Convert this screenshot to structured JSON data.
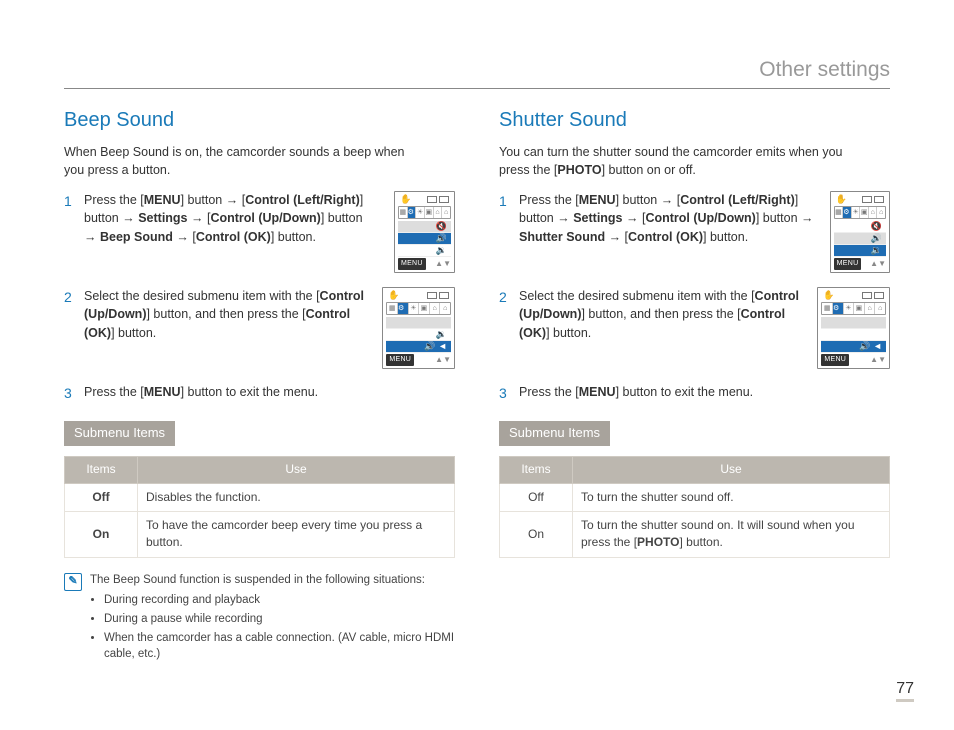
{
  "page_title": "Other settings",
  "page_number": "77",
  "beep": {
    "heading": "Beep Sound",
    "lead": "When Beep Sound is on, the camcorder sounds a beep when you press a button.",
    "steps": [
      {
        "num": "1",
        "pre": "Press the [",
        "btn": "MENU",
        "mid": "] button → [",
        "ctrl_lr": "Control (Left/Right)",
        "mid2": "] button → ",
        "settings": "Settings",
        "mid3": " → [",
        "ctrl_ud": "Control (Up/Down)",
        "mid4": "] button → ",
        "target": "Beep Sound",
        "mid5": " → [",
        "ctrl_ok": "Control (OK)",
        "post": "] button."
      },
      {
        "num": "2",
        "text_a": "Select the desired submenu item with the [",
        "ctrl_ud": "Control (Up/Down)",
        "text_b": "] button, and then press the [",
        "ctrl_ok": "Control (OK)",
        "text_c": "] button."
      },
      {
        "num": "3",
        "text_a": "Press the [",
        "btn": "MENU",
        "text_b": "] button to exit the menu."
      }
    ],
    "submenu_label": "Submenu Items",
    "table": {
      "h1": "Items",
      "h2": "Use",
      "rows": [
        {
          "item": "Off",
          "use": "Disables the function."
        },
        {
          "item": "On",
          "use": "To have the camcorder beep every time you press a button."
        }
      ]
    },
    "note_head": "The Beep Sound function is suspended in the following situations:",
    "note_items": [
      "During recording and playback",
      "During a pause while recording",
      "When the camcorder has a cable connection. (AV cable, micro HDMI cable, etc.)"
    ],
    "lcd_menu_label": "MENU"
  },
  "shutter": {
    "heading": "Shutter Sound",
    "lead_a": "You can turn the shutter sound the camcorder emits when you press the [",
    "lead_btn": "PHOTO",
    "lead_b": "] button on or off.",
    "steps": [
      {
        "num": "1",
        "pre": "Press the [",
        "btn": "MENU",
        "mid": "] button → [",
        "ctrl_lr": "Control (Left/Right)",
        "mid2": "] button → ",
        "settings": "Settings",
        "mid3": " → [",
        "ctrl_ud": "Control (Up/Down)",
        "mid4": "] button → ",
        "target": "Shutter Sound",
        "mid5": " → [",
        "ctrl_ok": "Control (OK)",
        "post": "] button."
      },
      {
        "num": "2",
        "text_a": "Select the desired submenu item with the [",
        "ctrl_ud": "Control (Up/Down)",
        "text_b": "] button, and then press the [",
        "ctrl_ok": "Control (OK)",
        "text_c": "] button."
      },
      {
        "num": "3",
        "text_a": "Press the [",
        "btn": "MENU",
        "text_b": "] button to exit the menu."
      }
    ],
    "submenu_label": "Submenu Items",
    "table": {
      "h1": "Items",
      "h2": "Use",
      "rows": [
        {
          "item": "Off",
          "use": "To turn the shutter sound off."
        },
        {
          "item": "On",
          "use_a": "To turn the shutter sound on. It will sound when you press the [",
          "btn": "PHOTO",
          "use_b": "] button."
        }
      ]
    },
    "lcd_menu_label": "MENU"
  }
}
